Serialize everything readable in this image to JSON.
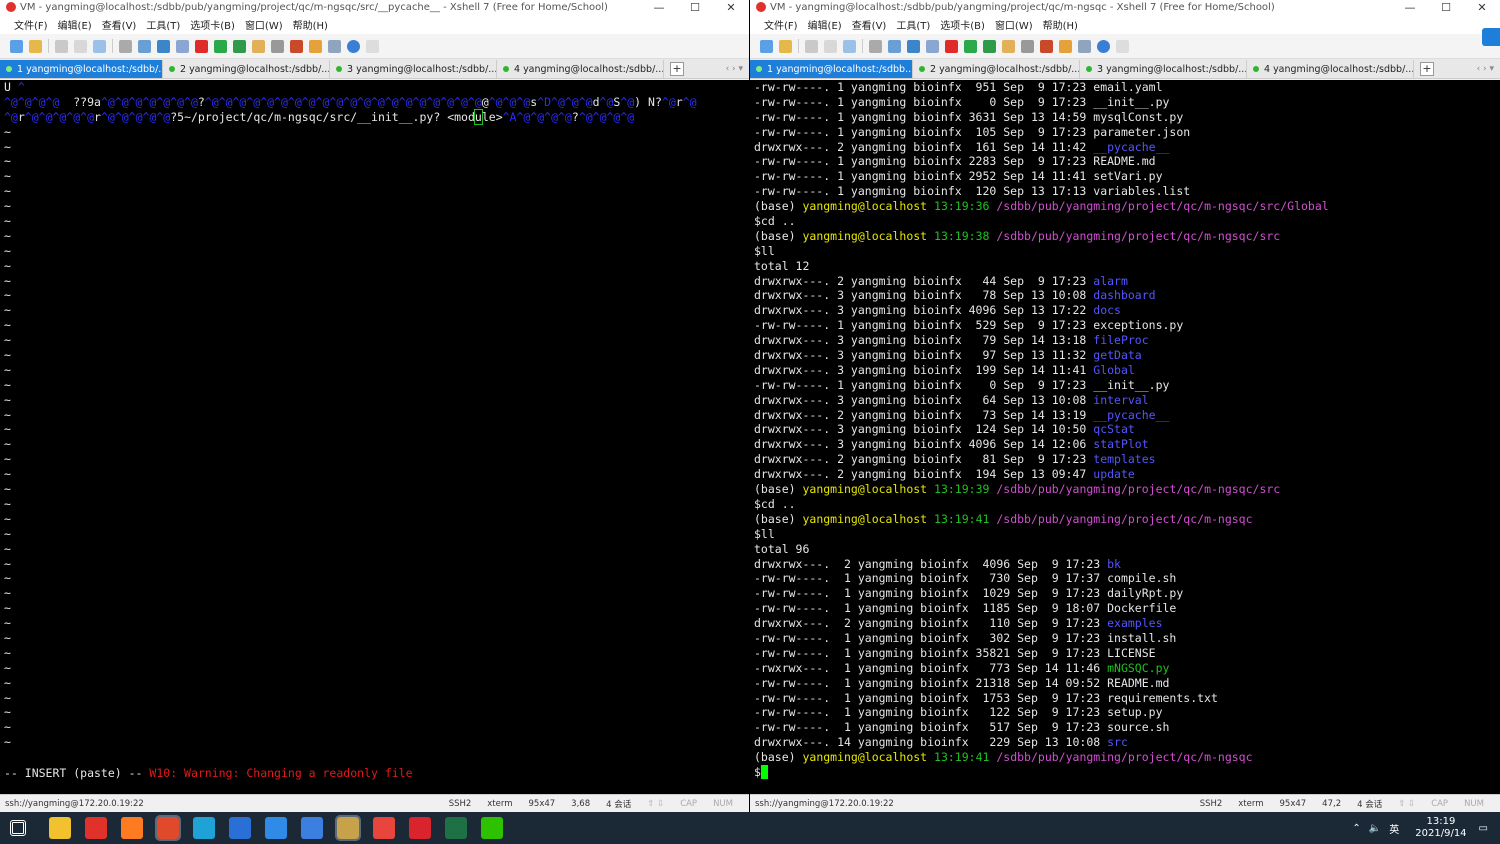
{
  "left": {
    "title": "VM - yangming@localhost:/sdbb/pub/yangming/project/qc/m-ngsqc/src/__pycache__ - Xshell 7 (Free for Home/School)",
    "menu": [
      "文件(F)",
      "编辑(E)",
      "查看(V)",
      "工具(T)",
      "选项卡(B)",
      "窗口(W)",
      "帮助(H)"
    ],
    "tabs": [
      "1 yangming@localhost:/sdbb/...",
      "2 yangming@localhost:/sdbb/...",
      "3 yangming@localhost:/sdbb/...",
      "4 yangming@localhost:/sdbb/..."
    ],
    "vim": {
      "line1": "U",
      "line2a": "  ??9a",
      "line2b": "?",
      "line2c": "@",
      "line2d": "s",
      "line2e": "d",
      "line2f": "S",
      "line2g": ")",
      "line2h": "N?",
      "line2i": "r",
      "line3a": "r",
      "line3b": "r",
      "line3c": "?5~/project/qc/m-ngsqc/src/__init__.py?",
      "line3d": "<mod",
      "line3e": "u",
      "line3f": "le>",
      "line3g": "?",
      "mode": "-- INSERT (paste) --",
      "warning": "W10: Warning: Changing a readonly file"
    },
    "status": {
      "conn": "ssh://yangming@172.20.0.19:22",
      "proto": "SSH2",
      "term": "xterm",
      "size": "95x47",
      "pos": "3,68",
      "sessions": "4 会话",
      "caps": "CAP",
      "num": "NUM"
    }
  },
  "right": {
    "title": "VM - yangming@localhost:/sdbb/pub/yangming/project/qc/m-ngsqc - Xshell 7 (Free for Home/School)",
    "menu": [
      "文件(F)",
      "编辑(E)",
      "查看(V)",
      "工具(T)",
      "选项卡(B)",
      "窗口(W)",
      "帮助(H)"
    ],
    "tabs": [
      "1 yangming@localhost:/sdbb...",
      "2 yangming@localhost:/sdbb/...",
      "3 yangming@localhost:/sdbb/...",
      "4 yangming@localhost:/sdbb/..."
    ],
    "listing1": [
      {
        "perm": "-rw-rw----.",
        "n": "1",
        "user": "yangming",
        "group": "bioinfx",
        "size": " 951",
        "mon": "Sep",
        "day": " 9",
        "time": "17:23",
        "name": "email.yaml",
        "kind": "file"
      },
      {
        "perm": "-rw-rw----.",
        "n": "1",
        "user": "yangming",
        "group": "bioinfx",
        "size": "   0",
        "mon": "Sep",
        "day": " 9",
        "time": "17:23",
        "name": "__init__.py",
        "kind": "file"
      },
      {
        "perm": "-rw-rw----.",
        "n": "1",
        "user": "yangming",
        "group": "bioinfx",
        "size": "3631",
        "mon": "Sep",
        "day": "13",
        "time": "14:59",
        "name": "mysqlConst.py",
        "kind": "file"
      },
      {
        "perm": "-rw-rw----.",
        "n": "1",
        "user": "yangming",
        "group": "bioinfx",
        "size": " 105",
        "mon": "Sep",
        "day": " 9",
        "time": "17:23",
        "name": "parameter.json",
        "kind": "file"
      },
      {
        "perm": "drwxrwx---.",
        "n": "2",
        "user": "yangming",
        "group": "bioinfx",
        "size": " 161",
        "mon": "Sep",
        "day": "14",
        "time": "11:42",
        "name": "__pycache__",
        "kind": "dir"
      },
      {
        "perm": "-rw-rw----.",
        "n": "1",
        "user": "yangming",
        "group": "bioinfx",
        "size": "2283",
        "mon": "Sep",
        "day": " 9",
        "time": "17:23",
        "name": "README.md",
        "kind": "file"
      },
      {
        "perm": "-rw-rw----.",
        "n": "1",
        "user": "yangming",
        "group": "bioinfx",
        "size": "2952",
        "mon": "Sep",
        "day": "14",
        "time": "11:41",
        "name": "setVari.py",
        "kind": "file"
      },
      {
        "perm": "-rw-rw----.",
        "n": "1",
        "user": "yangming",
        "group": "bioinfx",
        "size": " 120",
        "mon": "Sep",
        "day": "13",
        "time": "17:13",
        "name": "variables.list",
        "kind": "file"
      }
    ],
    "prompt1": {
      "env": "(base)",
      "user": "yangming@localhost",
      "time": "13:19:36",
      "path": "/sdbb/pub/yangming/project/qc/m-ngsqc/src/Global"
    },
    "cmd1": "$cd ..",
    "prompt2": {
      "env": "(base)",
      "user": "yangming@localhost",
      "time": "13:19:38",
      "path": "/sdbb/pub/yangming/project/qc/m-ngsqc/src"
    },
    "cmd2": "$ll",
    "total1": "total 12",
    "listing2": [
      {
        "perm": "drwxrwx---.",
        "n": "2",
        "user": "yangming",
        "group": "bioinfx",
        "size": "  44",
        "mon": "Sep",
        "day": " 9",
        "time": "17:23",
        "name": "alarm",
        "kind": "dir"
      },
      {
        "perm": "drwxrwx---.",
        "n": "3",
        "user": "yangming",
        "group": "bioinfx",
        "size": "  78",
        "mon": "Sep",
        "day": "13",
        "time": "10:08",
        "name": "dashboard",
        "kind": "dir"
      },
      {
        "perm": "drwxrwx---.",
        "n": "3",
        "user": "yangming",
        "group": "bioinfx",
        "size": "4096",
        "mon": "Sep",
        "day": "13",
        "time": "17:22",
        "name": "docs",
        "kind": "dir"
      },
      {
        "perm": "-rw-rw----.",
        "n": "1",
        "user": "yangming",
        "group": "bioinfx",
        "size": " 529",
        "mon": "Sep",
        "day": " 9",
        "time": "17:23",
        "name": "exceptions.py",
        "kind": "file"
      },
      {
        "perm": "drwxrwx---.",
        "n": "3",
        "user": "yangming",
        "group": "bioinfx",
        "size": "  79",
        "mon": "Sep",
        "day": "14",
        "time": "13:18",
        "name": "fileProc",
        "kind": "dir"
      },
      {
        "perm": "drwxrwx---.",
        "n": "3",
        "user": "yangming",
        "group": "bioinfx",
        "size": "  97",
        "mon": "Sep",
        "day": "13",
        "time": "11:32",
        "name": "getData",
        "kind": "dir"
      },
      {
        "perm": "drwxrwx---.",
        "n": "3",
        "user": "yangming",
        "group": "bioinfx",
        "size": " 199",
        "mon": "Sep",
        "day": "14",
        "time": "11:41",
        "name": "Global",
        "kind": "dir"
      },
      {
        "perm": "-rw-rw----.",
        "n": "1",
        "user": "yangming",
        "group": "bioinfx",
        "size": "   0",
        "mon": "Sep",
        "day": " 9",
        "time": "17:23",
        "name": "__init__.py",
        "kind": "file"
      },
      {
        "perm": "drwxrwx---.",
        "n": "3",
        "user": "yangming",
        "group": "bioinfx",
        "size": "  64",
        "mon": "Sep",
        "day": "13",
        "time": "10:08",
        "name": "interval",
        "kind": "dir"
      },
      {
        "perm": "drwxrwx---.",
        "n": "2",
        "user": "yangming",
        "group": "bioinfx",
        "size": "  73",
        "mon": "Sep",
        "day": "14",
        "time": "13:19",
        "name": "__pycache__",
        "kind": "dir"
      },
      {
        "perm": "drwxrwx---.",
        "n": "3",
        "user": "yangming",
        "group": "bioinfx",
        "size": " 124",
        "mon": "Sep",
        "day": "14",
        "time": "10:50",
        "name": "qcStat",
        "kind": "dir"
      },
      {
        "perm": "drwxrwx---.",
        "n": "3",
        "user": "yangming",
        "group": "bioinfx",
        "size": "4096",
        "mon": "Sep",
        "day": "14",
        "time": "12:06",
        "name": "statPlot",
        "kind": "dir"
      },
      {
        "perm": "drwxrwx---.",
        "n": "2",
        "user": "yangming",
        "group": "bioinfx",
        "size": "  81",
        "mon": "Sep",
        "day": " 9",
        "time": "17:23",
        "name": "templates",
        "kind": "dir"
      },
      {
        "perm": "drwxrwx---.",
        "n": "2",
        "user": "yangming",
        "group": "bioinfx",
        "size": " 194",
        "mon": "Sep",
        "day": "13",
        "time": "09:47",
        "name": "update",
        "kind": "dir"
      }
    ],
    "prompt3": {
      "env": "(base)",
      "user": "yangming@localhost",
      "time": "13:19:39",
      "path": "/sdbb/pub/yangming/project/qc/m-ngsqc/src"
    },
    "cmd3": "$cd ..",
    "prompt4": {
      "env": "(base)",
      "user": "yangming@localhost",
      "time": "13:19:41",
      "path": "/sdbb/pub/yangming/project/qc/m-ngsqc"
    },
    "cmd4": "$ll",
    "total2": "total 96",
    "listing3": [
      {
        "perm": "drwxrwx---.",
        "n": " 2",
        "user": "yangming",
        "group": "bioinfx",
        "size": " 4096",
        "mon": "Sep",
        "day": " 9",
        "time": "17:23",
        "name": "bk",
        "kind": "dir"
      },
      {
        "perm": "-rw-rw----.",
        "n": " 1",
        "user": "yangming",
        "group": "bioinfx",
        "size": "  730",
        "mon": "Sep",
        "day": " 9",
        "time": "17:37",
        "name": "compile.sh",
        "kind": "file"
      },
      {
        "perm": "-rw-rw----.",
        "n": " 1",
        "user": "yangming",
        "group": "bioinfx",
        "size": " 1029",
        "mon": "Sep",
        "day": " 9",
        "time": "17:23",
        "name": "dailyRpt.py",
        "kind": "file"
      },
      {
        "perm": "-rw-rw----.",
        "n": " 1",
        "user": "yangming",
        "group": "bioinfx",
        "size": " 1185",
        "mon": "Sep",
        "day": " 9",
        "time": "18:07",
        "name": "Dockerfile",
        "kind": "file"
      },
      {
        "perm": "drwxrwx---.",
        "n": " 2",
        "user": "yangming",
        "group": "bioinfx",
        "size": "  110",
        "mon": "Sep",
        "day": " 9",
        "time": "17:23",
        "name": "examples",
        "kind": "dir"
      },
      {
        "perm": "-rw-rw----.",
        "n": " 1",
        "user": "yangming",
        "group": "bioinfx",
        "size": "  302",
        "mon": "Sep",
        "day": " 9",
        "time": "17:23",
        "name": "install.sh",
        "kind": "file"
      },
      {
        "perm": "-rw-rw----.",
        "n": " 1",
        "user": "yangming",
        "group": "bioinfx",
        "size": "35821",
        "mon": "Sep",
        "day": " 9",
        "time": "17:23",
        "name": "LICENSE",
        "kind": "file"
      },
      {
        "perm": "-rwxrwx---.",
        "n": " 1",
        "user": "yangming",
        "group": "bioinfx",
        "size": "  773",
        "mon": "Sep",
        "day": "14",
        "time": "11:46",
        "name": "mNGSQC.py",
        "kind": "exec"
      },
      {
        "perm": "-rw-rw----.",
        "n": " 1",
        "user": "yangming",
        "group": "bioinfx",
        "size": "21318",
        "mon": "Sep",
        "day": "14",
        "time": "09:52",
        "name": "README.md",
        "kind": "file"
      },
      {
        "perm": "-rw-rw----.",
        "n": " 1",
        "user": "yangming",
        "group": "bioinfx",
        "size": " 1753",
        "mon": "Sep",
        "day": " 9",
        "time": "17:23",
        "name": "requirements.txt",
        "kind": "file"
      },
      {
        "perm": "-rw-rw----.",
        "n": " 1",
        "user": "yangming",
        "group": "bioinfx",
        "size": "  122",
        "mon": "Sep",
        "day": " 9",
        "time": "17:23",
        "name": "setup.py",
        "kind": "file"
      },
      {
        "perm": "-rw-rw----.",
        "n": " 1",
        "user": "yangming",
        "group": "bioinfx",
        "size": "  517",
        "mon": "Sep",
        "day": " 9",
        "time": "17:23",
        "name": "source.sh",
        "kind": "file"
      },
      {
        "perm": "drwxrwx---.",
        "n": "14",
        "user": "yangming",
        "group": "bioinfx",
        "size": "  229",
        "mon": "Sep",
        "day": "13",
        "time": "10:08",
        "name": "src",
        "kind": "dir"
      }
    ],
    "prompt5": {
      "env": "(base)",
      "user": "yangming@localhost",
      "time": "13:19:41",
      "path": "/sdbb/pub/yangming/project/qc/m-ngsqc"
    },
    "cmd5": "$",
    "status": {
      "conn": "ssh://yangming@172.20.0.19:22",
      "proto": "SSH2",
      "term": "xterm",
      "size": "95x47",
      "pos": "47,2",
      "sessions": "4 会话",
      "caps": "CAP",
      "num": "NUM"
    }
  },
  "taskbar": {
    "apps": [
      {
        "icon": "windows-start-icon",
        "color": "#ffffff"
      },
      {
        "icon": "file-explorer-icon",
        "color": "#f2c12e"
      },
      {
        "icon": "app-red-icon",
        "color": "#e0322b"
      },
      {
        "icon": "firefox-icon",
        "color": "#ff7b22"
      },
      {
        "icon": "xshell-icon",
        "color": "#e04a2b"
      },
      {
        "icon": "edge-icon",
        "color": "#1fa3d6"
      },
      {
        "icon": "en-keyboard-icon",
        "color": "#2a6fd6"
      },
      {
        "icon": "feishu-icon",
        "color": "#2f8be6"
      },
      {
        "icon": "app-blue-icon",
        "color": "#3b7fe0"
      },
      {
        "icon": "app-gold-icon",
        "color": "#c8a24a"
      },
      {
        "icon": "chrome-icon",
        "color": "#e8453c"
      },
      {
        "icon": "app-red2-icon",
        "color": "#d9232d"
      },
      {
        "icon": "excel-icon",
        "color": "#1e7145"
      },
      {
        "icon": "wechat-icon",
        "color": "#2dc100"
      }
    ],
    "ime": "英",
    "time": "13:19",
    "date": "2021/9/14"
  }
}
